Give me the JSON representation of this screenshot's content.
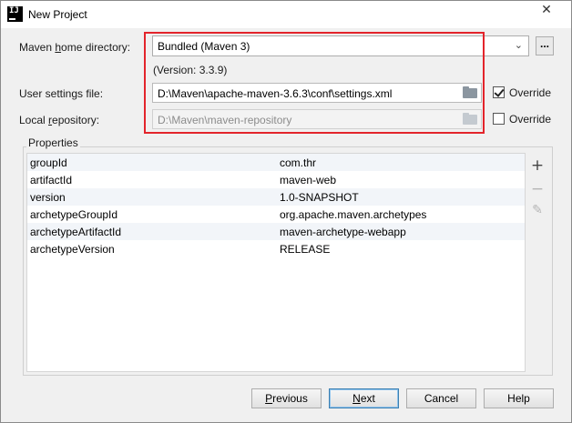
{
  "window": {
    "title": "New Project"
  },
  "maven": {
    "home_label": "Maven home directory:",
    "home_value": "Bundled (Maven 3)",
    "version_text": "(Version: 3.3.9)",
    "settings_label": "User settings file:",
    "settings_value": "D:\\Maven\\apache-maven-3.6.3\\conf\\settings.xml",
    "repo_label": "Local repository:",
    "repo_value": "D:\\Maven\\maven-repository",
    "override_label": "Override",
    "settings_override_checked": true,
    "repo_override_checked": false
  },
  "properties": {
    "title": "Properties",
    "rows": [
      {
        "key": "groupId",
        "value": "com.thr"
      },
      {
        "key": "artifactId",
        "value": "maven-web"
      },
      {
        "key": "version",
        "value": "1.0-SNAPSHOT"
      },
      {
        "key": "archetypeGroupId",
        "value": "org.apache.maven.archetypes"
      },
      {
        "key": "archetypeArtifactId",
        "value": "maven-archetype-webapp"
      },
      {
        "key": "archetypeVersion",
        "value": "RELEASE"
      }
    ]
  },
  "buttons": {
    "previous": "Previous",
    "next": "Next",
    "cancel": "Cancel",
    "help": "Help"
  },
  "icons": {
    "app": "intellij-icon",
    "close": "close-icon",
    "dropdown": "chevron-down-icon",
    "browse": "folder-icon",
    "add": "plus-icon",
    "remove": "minus-icon",
    "edit": "pencil-icon"
  },
  "colors": {
    "highlight": "#e3242b",
    "default_button": "#3c7fb1"
  }
}
